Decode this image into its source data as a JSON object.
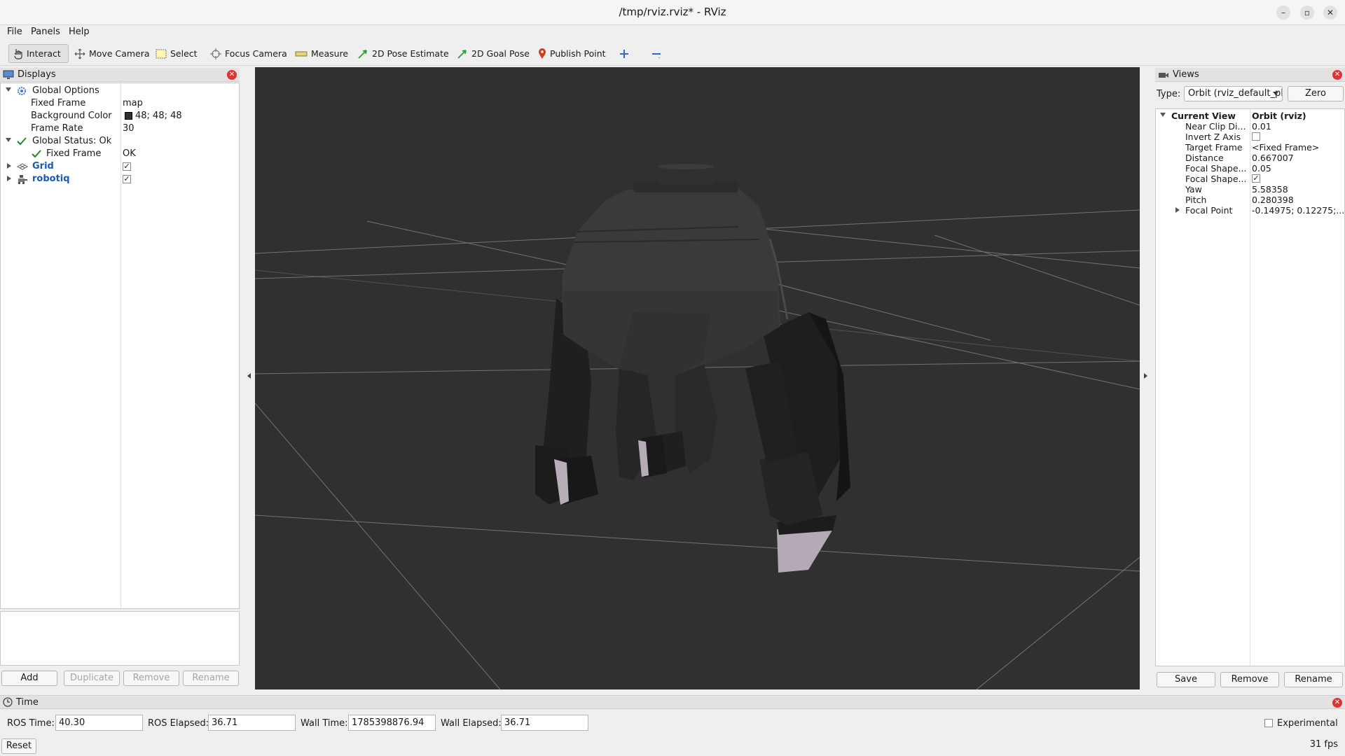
{
  "window": {
    "title": "/tmp/rviz.rviz* - RViz"
  },
  "menu": {
    "file": "File",
    "panels": "Panels",
    "help": "Help"
  },
  "toolbar": {
    "interact": "Interact",
    "move_camera": "Move Camera",
    "select": "Select",
    "focus_camera": "Focus Camera",
    "measure": "Measure",
    "pose_estimate": "2D Pose Estimate",
    "goal_pose": "2D Goal Pose",
    "publish_point": "Publish Point"
  },
  "displays": {
    "title": "Displays",
    "global_options": "Global Options",
    "fixed_frame_label": "Fixed Frame",
    "fixed_frame_value": "map",
    "background_color_label": "Background Color",
    "background_color_value": "48; 48; 48",
    "background_color_hex": "#303030",
    "frame_rate_label": "Frame Rate",
    "frame_rate_value": "30",
    "global_status": "Global Status: Ok",
    "status_fixed_frame_label": "Fixed Frame",
    "status_fixed_frame_value": "OK",
    "grid": "Grid",
    "grid_enabled": "✓",
    "robotiq": "robotiq",
    "robotiq_enabled": "✓",
    "buttons": {
      "add": "Add",
      "duplicate": "Duplicate",
      "remove": "Remove",
      "rename": "Rename"
    }
  },
  "views": {
    "title": "Views",
    "type_label": "Type:",
    "type_value": "Orbit (rviz_default_plugins)",
    "zero": "Zero",
    "current_view_label": "Current View",
    "current_view_value": "Orbit (rviz)",
    "props": [
      {
        "name": "Near Clip Di...",
        "value": "0.01"
      },
      {
        "name": "Invert Z Axis",
        "value": ""
      },
      {
        "name": "Target Frame",
        "value": "<Fixed Frame>"
      },
      {
        "name": "Distance",
        "value": "0.667007"
      },
      {
        "name": "Focal Shape...",
        "value": "0.05"
      },
      {
        "name": "Focal Shape...",
        "value": "✓"
      },
      {
        "name": "Yaw",
        "value": "5.58358"
      },
      {
        "name": "Pitch",
        "value": "0.280398"
      },
      {
        "name": "Focal Point",
        "value": "-0.14975; 0.12275;..."
      }
    ],
    "buttons": {
      "save": "Save",
      "remove": "Remove",
      "rename": "Rename"
    }
  },
  "time": {
    "title": "Time",
    "ros_time_label": "ROS Time:",
    "ros_time_value": "40.30",
    "ros_elapsed_label": "ROS Elapsed:",
    "ros_elapsed_value": "36.71",
    "wall_time_label": "Wall Time:",
    "wall_time_value": "1785398876.94",
    "wall_elapsed_label": "Wall Elapsed:",
    "wall_elapsed_value": "36.71",
    "experimental": "Experimental",
    "reset": "Reset",
    "fps": "31 fps"
  }
}
